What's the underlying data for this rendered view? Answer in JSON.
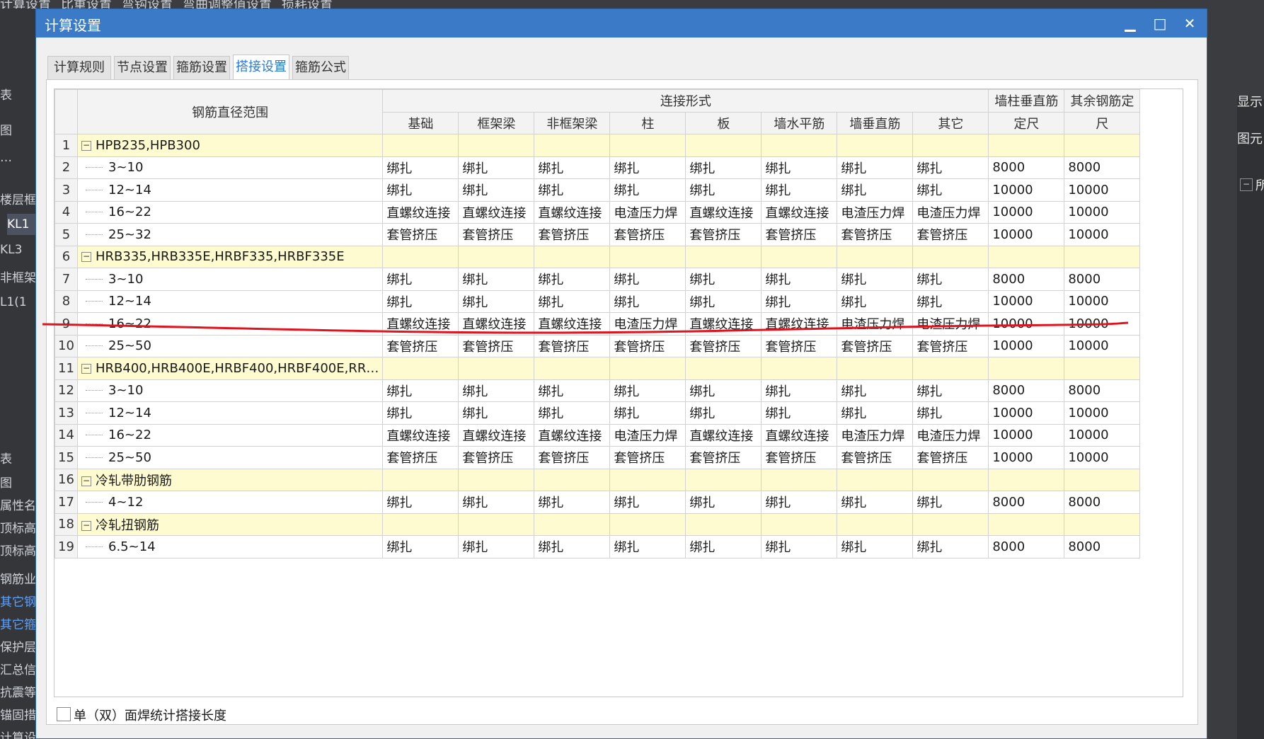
{
  "background": {
    "menu_items": [
      "计算设置",
      "比重设置",
      "弯钩设置",
      "弯曲调整值设置",
      "损耗设置"
    ],
    "left_panel": [
      "表",
      "图",
      "…",
      "楼层框架",
      "KL1",
      "KL3",
      "非框架梁",
      "L1(1",
      "表",
      "图",
      "属性名",
      "顶标高",
      "顶标高",
      "钢筋业务",
      "其它钢",
      "其它箍",
      "保护层",
      "汇总信",
      "抗震等",
      "锚固措",
      "计算设"
    ],
    "right_panel": {
      "label_display": "显示",
      "label_element": "图元",
      "label_all": "所"
    }
  },
  "dialog": {
    "title": "计算设置",
    "window_buttons": {
      "minimize": "▁",
      "maximize": "□",
      "close": "✕"
    },
    "tabs": [
      "计算规则",
      "节点设置",
      "箍筋设置",
      "搭接设置",
      "箍筋公式"
    ],
    "active_tab": 3,
    "table": {
      "header_range": "钢筋直径范围",
      "header_connection": "连接形式",
      "connection_columns": [
        "基础",
        "框架梁",
        "非框架梁",
        "柱",
        "板",
        "墙水平筋",
        "墙垂直筋",
        "其它"
      ],
      "header_wall_column_length": [
        "墙柱垂直筋",
        "定尺"
      ],
      "header_other_length": [
        "其余钢筋定",
        "尺"
      ],
      "rows": [
        {
          "num": "1",
          "type": "group",
          "label": "HPB235,HPB300",
          "collapse": "−",
          "cells": [
            "",
            "",
            "",
            "",
            "",
            "",
            "",
            ""
          ],
          "len1": "",
          "len2": ""
        },
        {
          "num": "2",
          "type": "item",
          "label": "3~10",
          "cells": [
            "绑扎",
            "绑扎",
            "绑扎",
            "绑扎",
            "绑扎",
            "绑扎",
            "绑扎",
            "绑扎"
          ],
          "len1": "8000",
          "len2": "8000"
        },
        {
          "num": "3",
          "type": "item",
          "label": "12~14",
          "cells": [
            "绑扎",
            "绑扎",
            "绑扎",
            "绑扎",
            "绑扎",
            "绑扎",
            "绑扎",
            "绑扎"
          ],
          "len1": "10000",
          "len2": "10000"
        },
        {
          "num": "4",
          "type": "item",
          "label": "16~22",
          "cells": [
            "直螺纹连接",
            "直螺纹连接",
            "直螺纹连接",
            "电渣压力焊",
            "直螺纹连接",
            "直螺纹连接",
            "电渣压力焊",
            "电渣压力焊"
          ],
          "len1": "10000",
          "len2": "10000"
        },
        {
          "num": "5",
          "type": "item",
          "label": "25~32",
          "cells": [
            "套管挤压",
            "套管挤压",
            "套管挤压",
            "套管挤压",
            "套管挤压",
            "套管挤压",
            "套管挤压",
            "套管挤压"
          ],
          "len1": "10000",
          "len2": "10000"
        },
        {
          "num": "6",
          "type": "group",
          "label": "HRB335,HRB335E,HRBF335,HRBF335E",
          "collapse": "−",
          "cells": [
            "",
            "",
            "",
            "",
            "",
            "",
            "",
            ""
          ],
          "len1": "",
          "len2": ""
        },
        {
          "num": "7",
          "type": "item",
          "label": "3~10",
          "cells": [
            "绑扎",
            "绑扎",
            "绑扎",
            "绑扎",
            "绑扎",
            "绑扎",
            "绑扎",
            "绑扎"
          ],
          "len1": "8000",
          "len2": "8000"
        },
        {
          "num": "8",
          "type": "item",
          "label": "12~14",
          "cells": [
            "绑扎",
            "绑扎",
            "绑扎",
            "绑扎",
            "绑扎",
            "绑扎",
            "绑扎",
            "绑扎"
          ],
          "len1": "10000",
          "len2": "10000"
        },
        {
          "num": "9",
          "type": "item",
          "label": "16~22",
          "cells": [
            "直螺纹连接",
            "直螺纹连接",
            "直螺纹连接",
            "电渣压力焊",
            "直螺纹连接",
            "直螺纹连接",
            "电渣压力焊",
            "电渣压力焊"
          ],
          "len1": "10000",
          "len2": "10000"
        },
        {
          "num": "10",
          "type": "item",
          "label": "25~50",
          "cells": [
            "套管挤压",
            "套管挤压",
            "套管挤压",
            "套管挤压",
            "套管挤压",
            "套管挤压",
            "套管挤压",
            "套管挤压"
          ],
          "len1": "10000",
          "len2": "10000"
        },
        {
          "num": "11",
          "type": "group",
          "label": "HRB400,HRB400E,HRBF400,HRBF400E,RR…",
          "collapse": "−",
          "cells": [
            "",
            "",
            "",
            "",
            "",
            "",
            "",
            ""
          ],
          "len1": "",
          "len2": ""
        },
        {
          "num": "12",
          "type": "item",
          "label": "3~10",
          "cells": [
            "绑扎",
            "绑扎",
            "绑扎",
            "绑扎",
            "绑扎",
            "绑扎",
            "绑扎",
            "绑扎"
          ],
          "len1": "8000",
          "len2": "8000"
        },
        {
          "num": "13",
          "type": "item",
          "label": "12~14",
          "cells": [
            "绑扎",
            "绑扎",
            "绑扎",
            "绑扎",
            "绑扎",
            "绑扎",
            "绑扎",
            "绑扎"
          ],
          "len1": "10000",
          "len2": "10000"
        },
        {
          "num": "14",
          "type": "item",
          "label": "16~22",
          "cells": [
            "直螺纹连接",
            "直螺纹连接",
            "直螺纹连接",
            "电渣压力焊",
            "直螺纹连接",
            "直螺纹连接",
            "电渣压力焊",
            "电渣压力焊"
          ],
          "len1": "10000",
          "len2": "10000"
        },
        {
          "num": "15",
          "type": "item",
          "label": "25~50",
          "cells": [
            "套管挤压",
            "套管挤压",
            "套管挤压",
            "套管挤压",
            "套管挤压",
            "套管挤压",
            "套管挤压",
            "套管挤压"
          ],
          "len1": "10000",
          "len2": "10000"
        },
        {
          "num": "16",
          "type": "group",
          "label": "冷轧带肋钢筋",
          "collapse": "−",
          "cells": [
            "",
            "",
            "",
            "",
            "",
            "",
            "",
            ""
          ],
          "len1": "",
          "len2": ""
        },
        {
          "num": "17",
          "type": "item",
          "label": "4~12",
          "cells": [
            "绑扎",
            "绑扎",
            "绑扎",
            "绑扎",
            "绑扎",
            "绑扎",
            "绑扎",
            "绑扎"
          ],
          "len1": "8000",
          "len2": "8000"
        },
        {
          "num": "18",
          "type": "group",
          "label": "冷轧扭钢筋",
          "collapse": "−",
          "cells": [
            "",
            "",
            "",
            "",
            "",
            "",
            "",
            ""
          ],
          "len1": "",
          "len2": ""
        },
        {
          "num": "19",
          "type": "item",
          "label": "6.5~14",
          "cells": [
            "绑扎",
            "绑扎",
            "绑扎",
            "绑扎",
            "绑扎",
            "绑扎",
            "绑扎",
            "绑扎"
          ],
          "len1": "8000",
          "len2": "8000"
        }
      ]
    },
    "checkbox_label": "单（双）面焊统计搭接长度",
    "checkbox_checked": false
  },
  "colors": {
    "titlebar": "#3a7ac6",
    "active_tab_text": "#2a7ad6",
    "group_row_bg": "#fffbd0",
    "annotation_line": "#e0141e"
  }
}
